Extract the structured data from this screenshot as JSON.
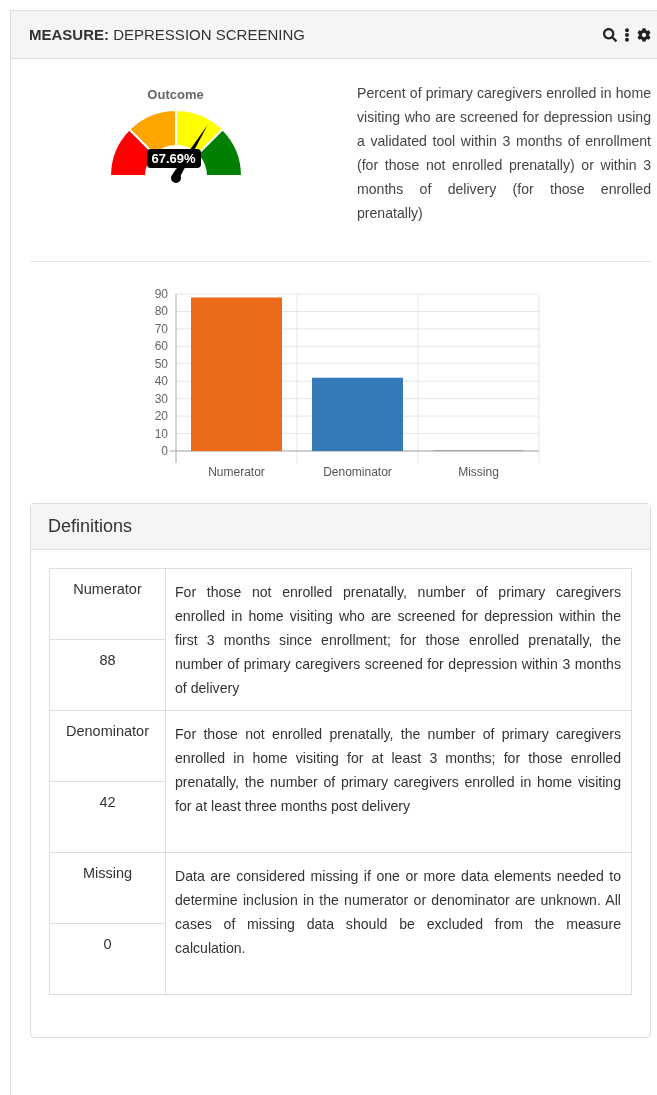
{
  "header": {
    "label": "MEASURE:",
    "title": "DEPRESSION SCREENING"
  },
  "gauge": {
    "title": "Outcome",
    "reading": "67.69%"
  },
  "description": "Percent of primary caregivers enrolled in home visiting who are screened for depression using a validated tool within 3 months of enrollment (for those not enrolled prenatally) or within 3 months of delivery (for those enrolled prenatally)",
  "chart_data": {
    "type": "bar",
    "grid": true,
    "categories": [
      "Numerator",
      "Denominator",
      "Missing"
    ],
    "ylim": [
      0,
      90
    ],
    "yticks": [
      0,
      10,
      20,
      30,
      40,
      50,
      60,
      70,
      80,
      90
    ],
    "values": [
      88,
      42,
      0
    ],
    "colors": [
      "#ec6b1a",
      "#337ab7",
      "#aaaaaa"
    ]
  },
  "definitions": {
    "title": "Definitions",
    "rows": [
      {
        "label": "Numerator",
        "value": "88",
        "text": "For those not enrolled prenatally, number of primary caregivers enrolled in home visiting who are screened for depression within the first 3 months since enrollment; for those enrolled prenatally, the number of primary caregivers screened for depression within 3 months of delivery"
      },
      {
        "label": "Denominator",
        "value": "42",
        "text": "For those not enrolled prenatally, the number of primary caregivers enrolled in home visiting for at least 3 months; for those enrolled prenatally, the number of primary caregivers enrolled in home visiting for at least three months post delivery"
      },
      {
        "label": "Missing",
        "value": "0",
        "text": "Data are considered missing if one or more data elements needed to determine inclusion in the numerator or denominator are unknown. All cases of missing data should be excluded from the measure calculation."
      }
    ]
  }
}
